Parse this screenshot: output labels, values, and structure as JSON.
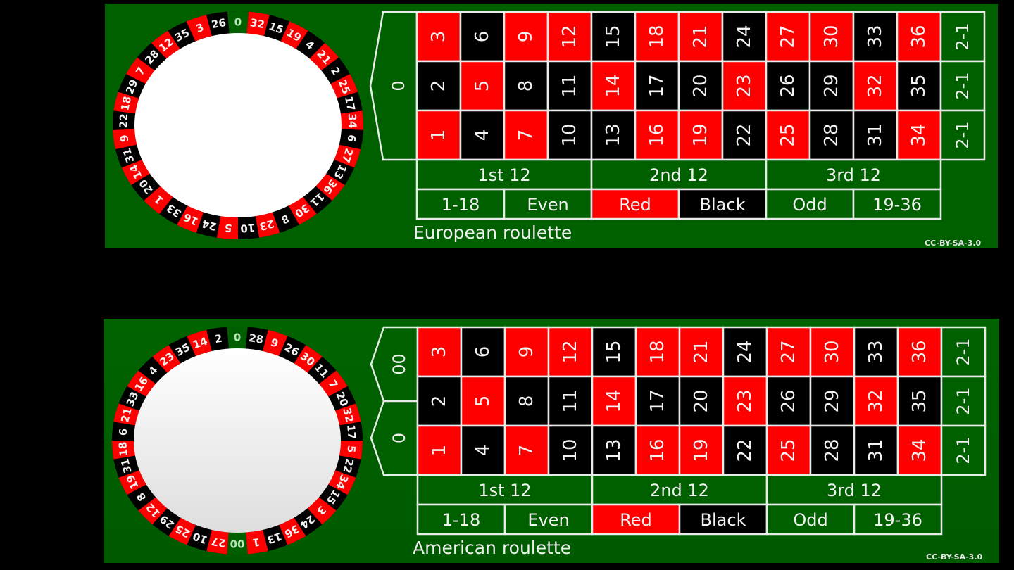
{
  "colors": {
    "felt": "#006000",
    "red": "#ff0000",
    "black": "#000000",
    "line": "#e8ece8",
    "text": "#f2f2f2",
    "wheel_center": "#ffffff"
  },
  "european": {
    "caption": "European roulette",
    "license": "CC-BY-SA-3.0",
    "zeros": [
      "0"
    ],
    "wheel": [
      "0",
      "32",
      "15",
      "19",
      "4",
      "21",
      "2",
      "25",
      "17",
      "34",
      "6",
      "27",
      "13",
      "36",
      "11",
      "30",
      "8",
      "23",
      "10",
      "5",
      "24",
      "16",
      "33",
      "1",
      "20",
      "14",
      "31",
      "9",
      "22",
      "18",
      "29",
      "7",
      "28",
      "12",
      "35",
      "3",
      "26"
    ]
  },
  "american": {
    "caption": "American roulette",
    "license": "CC-BY-SA-3.0",
    "zeros": [
      "00",
      "0"
    ],
    "wheel": [
      "0",
      "28",
      "9",
      "26",
      "30",
      "11",
      "7",
      "20",
      "32",
      "17",
      "5",
      "22",
      "34",
      "15",
      "3",
      "24",
      "36",
      "13",
      "1",
      "00",
      "27",
      "10",
      "25",
      "29",
      "12",
      "8",
      "19",
      "31",
      "18",
      "6",
      "21",
      "33",
      "16",
      "4",
      "23",
      "35",
      "14",
      "2"
    ]
  },
  "red_numbers": [
    1,
    3,
    5,
    7,
    9,
    12,
    14,
    16,
    18,
    19,
    21,
    23,
    25,
    27,
    30,
    32,
    34,
    36
  ],
  "column_bets": [
    "2-1",
    "2-1",
    "2-1"
  ],
  "dozens": [
    "1st 12",
    "2nd 12",
    "3rd 12"
  ],
  "outside_bets": [
    {
      "label": "1-18",
      "color": "felt"
    },
    {
      "label": "Even",
      "color": "felt"
    },
    {
      "label": "Red",
      "color": "red"
    },
    {
      "label": "Black",
      "color": "black"
    },
    {
      "label": "Odd",
      "color": "felt"
    },
    {
      "label": "19-36",
      "color": "felt"
    }
  ]
}
